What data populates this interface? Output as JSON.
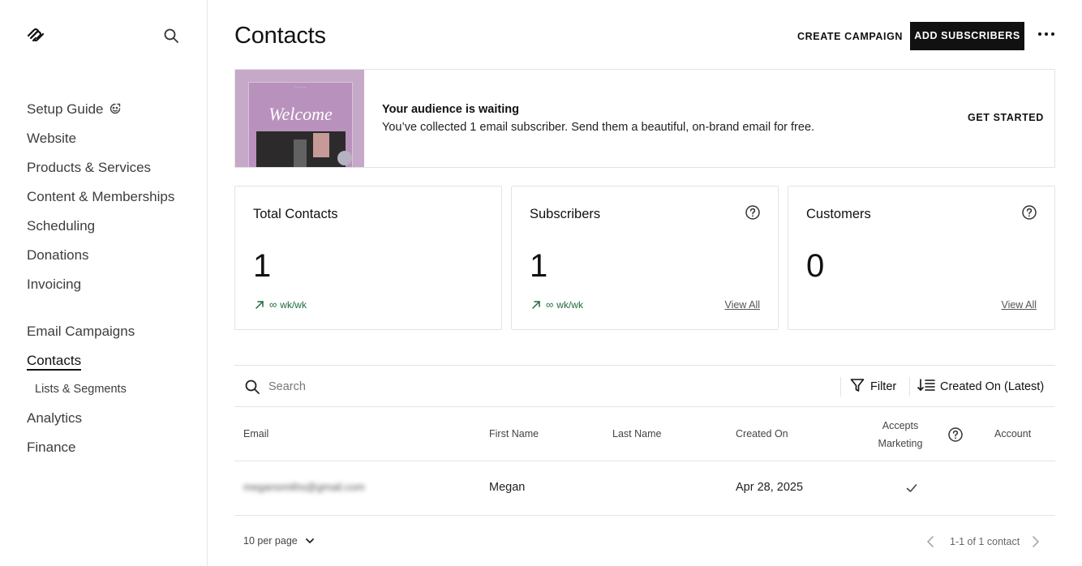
{
  "sidebar": {
    "items": [
      {
        "label": "Setup Guide"
      },
      {
        "label": "Website"
      },
      {
        "label": "Products & Services"
      },
      {
        "label": "Content & Memberships"
      },
      {
        "label": "Scheduling"
      },
      {
        "label": "Donations"
      },
      {
        "label": "Invoicing"
      },
      {
        "label": "Email Campaigns"
      },
      {
        "label": "Contacts"
      },
      {
        "label": "Lists & Segments"
      },
      {
        "label": "Analytics"
      },
      {
        "label": "Finance"
      }
    ],
    "active": "Contacts"
  },
  "header": {
    "title": "Contacts",
    "create_label": "CREATE CAMPAIGN",
    "add_label": "ADD SUBSCRIBERS"
  },
  "banner": {
    "card_word": "Welcome",
    "title": "Your audience is waiting",
    "text": "You’ve collected 1 email subscriber. Send them a beautiful, on-brand email for free.",
    "cta": "GET STARTED"
  },
  "stats": [
    {
      "title": "Total Contacts",
      "value": "1",
      "trend": "wk/wk",
      "trend_symbol": "∞"
    },
    {
      "title": "Subscribers",
      "value": "1",
      "trend": "wk/wk",
      "trend_symbol": "∞",
      "link": "View All"
    },
    {
      "title": "Customers",
      "value": "0",
      "link": "View All"
    }
  ],
  "table": {
    "search_placeholder": "Search",
    "filter_label": "Filter",
    "sort_label": "Created On (Latest)",
    "columns": {
      "email": "Email",
      "first_name": "First Name",
      "last_name": "Last Name",
      "created_on": "Created On",
      "accepts_marketing_line1": "Accepts",
      "accepts_marketing_line2": "Marketing",
      "account": "Account"
    },
    "rows": [
      {
        "email": "megansmiths@gmail.com",
        "first_name": "Megan",
        "last_name": "",
        "created_on": "Apr 28, 2025",
        "accepts_marketing": true
      }
    ],
    "per_page": "10 per page",
    "page_info": "1-1 of 1 contact"
  },
  "colors": {
    "accent_dark": "#111111",
    "trend_green": "#1d6b3a",
    "banner_purple": "#b891bd"
  }
}
